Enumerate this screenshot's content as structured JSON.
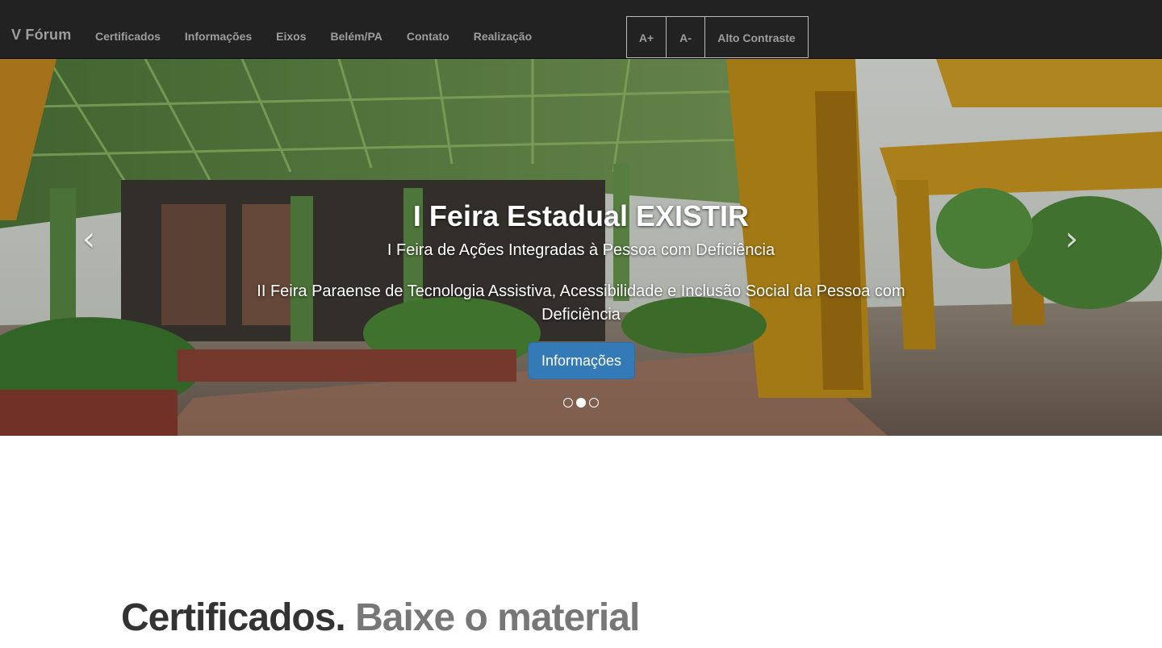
{
  "navbar": {
    "brand": "V Fórum",
    "links": [
      "Certificados",
      "Informações",
      "Eixos",
      "Belém/PA",
      "Contato",
      "Realização"
    ],
    "accessibility": {
      "increase": "A+",
      "decrease": "A-",
      "contrast": "Alto Contraste"
    }
  },
  "carousel": {
    "title": "I Feira Estadual EXISTIR",
    "subtitle1": "I Feira de Ações Integradas à Pessoa com Deficiência",
    "subtitle2": "II Feira Paraense de Tecnologia Assistiva, Acessibilidade e Inclusão Social da Pessoa com Deficiência",
    "button": "Informações",
    "prev_icon": "chevron-left-icon",
    "next_icon": "chevron-right-icon",
    "slide_count": 3,
    "active_slide": 2
  },
  "feature": {
    "heading": "Certificados.",
    "muted": "Baixe o material"
  },
  "colors": {
    "navbar_bg": "#222222",
    "nav_text": "#9d9d9d",
    "button_primary": "#337ab7"
  }
}
